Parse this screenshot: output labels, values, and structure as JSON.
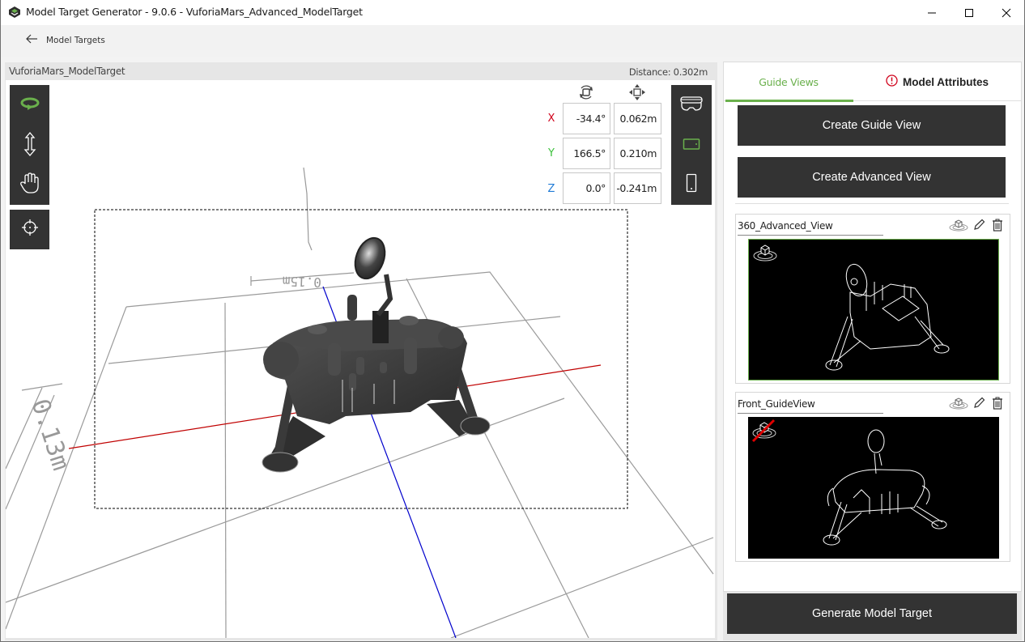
{
  "window": {
    "title": "Model Target Generator - 9.0.6 - VuforiaMars_Advanced_ModelTarget",
    "controls": [
      "minimize",
      "maximize",
      "close"
    ]
  },
  "nav": {
    "back_icon": "arrow-left-icon",
    "back_label": "Model Targets"
  },
  "viewport": {
    "model_name": "VuforiaMars_ModelTarget",
    "distance_label": "Distance:",
    "distance_value": "0.302m",
    "left_tools": [
      {
        "name": "orbit",
        "icon": "orbit-icon",
        "active": true
      },
      {
        "name": "zoom",
        "icon": "vertical-arrows-icon",
        "active": false
      },
      {
        "name": "pan",
        "icon": "hand-icon",
        "active": false
      }
    ],
    "center_tool": {
      "name": "recenter",
      "icon": "crosshair-icon"
    },
    "pose": {
      "rotation_icon": "rotate-icon",
      "translation_icon": "move-icon",
      "rows": [
        {
          "axis": "X",
          "color": "#d0021b",
          "rotation": "-34.4°",
          "translation": "0.062m"
        },
        {
          "axis": "Y",
          "color": "#3cc13c",
          "rotation": "166.5°",
          "translation": "0.210m"
        },
        {
          "axis": "Z",
          "color": "#1f7ad6",
          "rotation": "0.0°",
          "translation": "-0.241m"
        }
      ]
    },
    "device_tools": [
      {
        "name": "headset",
        "icon": "headset-icon",
        "active": false
      },
      {
        "name": "tablet",
        "icon": "tablet-icon",
        "active": true
      },
      {
        "name": "phone",
        "icon": "phone-icon",
        "active": false
      }
    ],
    "scale_labels": {
      "horizontal": "0.15m",
      "vertical": "0.13m"
    },
    "colors": {
      "x_axis": "#c00000",
      "z_axis": "#0000cc",
      "grid": "#999999",
      "active_tool": "#6ab04c"
    }
  },
  "panel": {
    "tabs": [
      {
        "label": "Guide Views",
        "active": true
      },
      {
        "label": "Model Attributes",
        "active": false,
        "warning": true
      }
    ],
    "create_guide_view": "Create Guide View",
    "create_advanced_view": "Create Advanced View",
    "views": [
      {
        "name": "360_Advanced_View",
        "selected": true,
        "type": "advanced",
        "actions": [
          "view-cube-icon",
          "pencil-icon",
          "trash-icon"
        ]
      },
      {
        "name": "Front_GuideView",
        "selected": false,
        "type": "guide",
        "actions": [
          "view-cube-icon",
          "pencil-icon",
          "trash-icon"
        ]
      }
    ],
    "generate_button": "Generate Model Target"
  }
}
